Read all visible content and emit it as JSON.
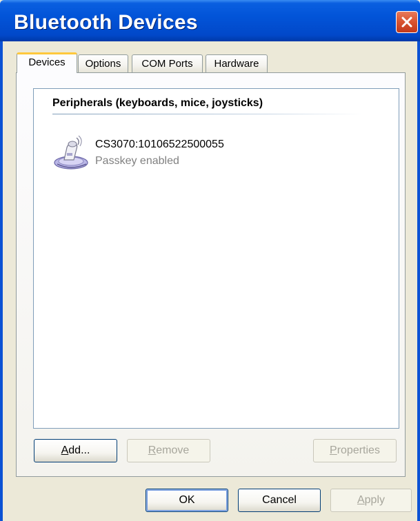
{
  "window": {
    "title": "Bluetooth Devices"
  },
  "tabs": [
    {
      "label": "Devices",
      "active": true
    },
    {
      "label": "Options",
      "active": false
    },
    {
      "label": "COM Ports",
      "active": false
    },
    {
      "label": "Hardware",
      "active": false
    }
  ],
  "devices_tab": {
    "group_header": "Peripherals (keyboards, mice, joysticks)",
    "devices": [
      {
        "name": "CS3070:10106522500055",
        "status": "Passkey enabled",
        "icon": "bluetooth-scanner-icon"
      }
    ],
    "add_button": {
      "label_mnemonic": "A",
      "label_rest": "dd...",
      "enabled": true
    },
    "remove_button": {
      "label_mnemonic": "R",
      "label_rest": "emove",
      "enabled": false
    },
    "properties_button": {
      "label_mnemonic": "P",
      "label_rest": "roperties",
      "enabled": false
    }
  },
  "dialog_buttons": {
    "ok": "OK",
    "cancel": "Cancel",
    "apply_mnemonic": "A",
    "apply_rest": "pply"
  },
  "colors": {
    "titlebar": "#0254d8",
    "close_button": "#d8532f",
    "active_tab_highlight": "#ffc83c",
    "dialog_background": "#ece9d8"
  }
}
